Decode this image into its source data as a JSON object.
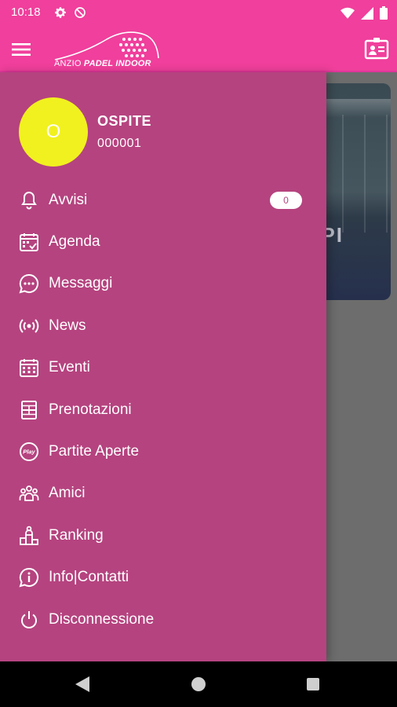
{
  "status_bar": {
    "time": "10:18",
    "icons": [
      "gear-icon",
      "sync-off-icon",
      "wifi-icon",
      "signal-icon",
      "battery-icon"
    ]
  },
  "app_bar": {
    "logo_word1": "ANZIO",
    "logo_word2": "PADEL INDOOR",
    "icons": [
      "menu-icon",
      "profile-card-icon"
    ],
    "color": "#f03f9c"
  },
  "drawer": {
    "color": "#b5437f",
    "avatar_initial": "O",
    "avatar_color": "#f1f11f",
    "user_name": "OSPITE",
    "user_code": "000001",
    "items": [
      {
        "label": "Avvisi",
        "icon": "bell-icon",
        "badge": "0"
      },
      {
        "label": "Agenda",
        "icon": "calendar-check-icon"
      },
      {
        "label": "Messaggi",
        "icon": "chat-icon"
      },
      {
        "label": "News",
        "icon": "broadcast-icon"
      },
      {
        "label": "Eventi",
        "icon": "calendar-grid-icon"
      },
      {
        "label": "Prenotazioni",
        "icon": "court-icon"
      },
      {
        "label": "Partite Aperte",
        "icon": "play-badge-icon"
      },
      {
        "label": "Amici",
        "icon": "friends-icon"
      },
      {
        "label": "Ranking",
        "icon": "podium-icon"
      },
      {
        "label": "Info|Contatti",
        "icon": "info-chat-icon"
      },
      {
        "label": "Disconnessione",
        "icon": "power-icon"
      }
    ]
  },
  "background": {
    "card_partial_text": "PI"
  },
  "nav_bar": {
    "icons": [
      "back-icon",
      "home-icon",
      "recents-icon"
    ]
  }
}
